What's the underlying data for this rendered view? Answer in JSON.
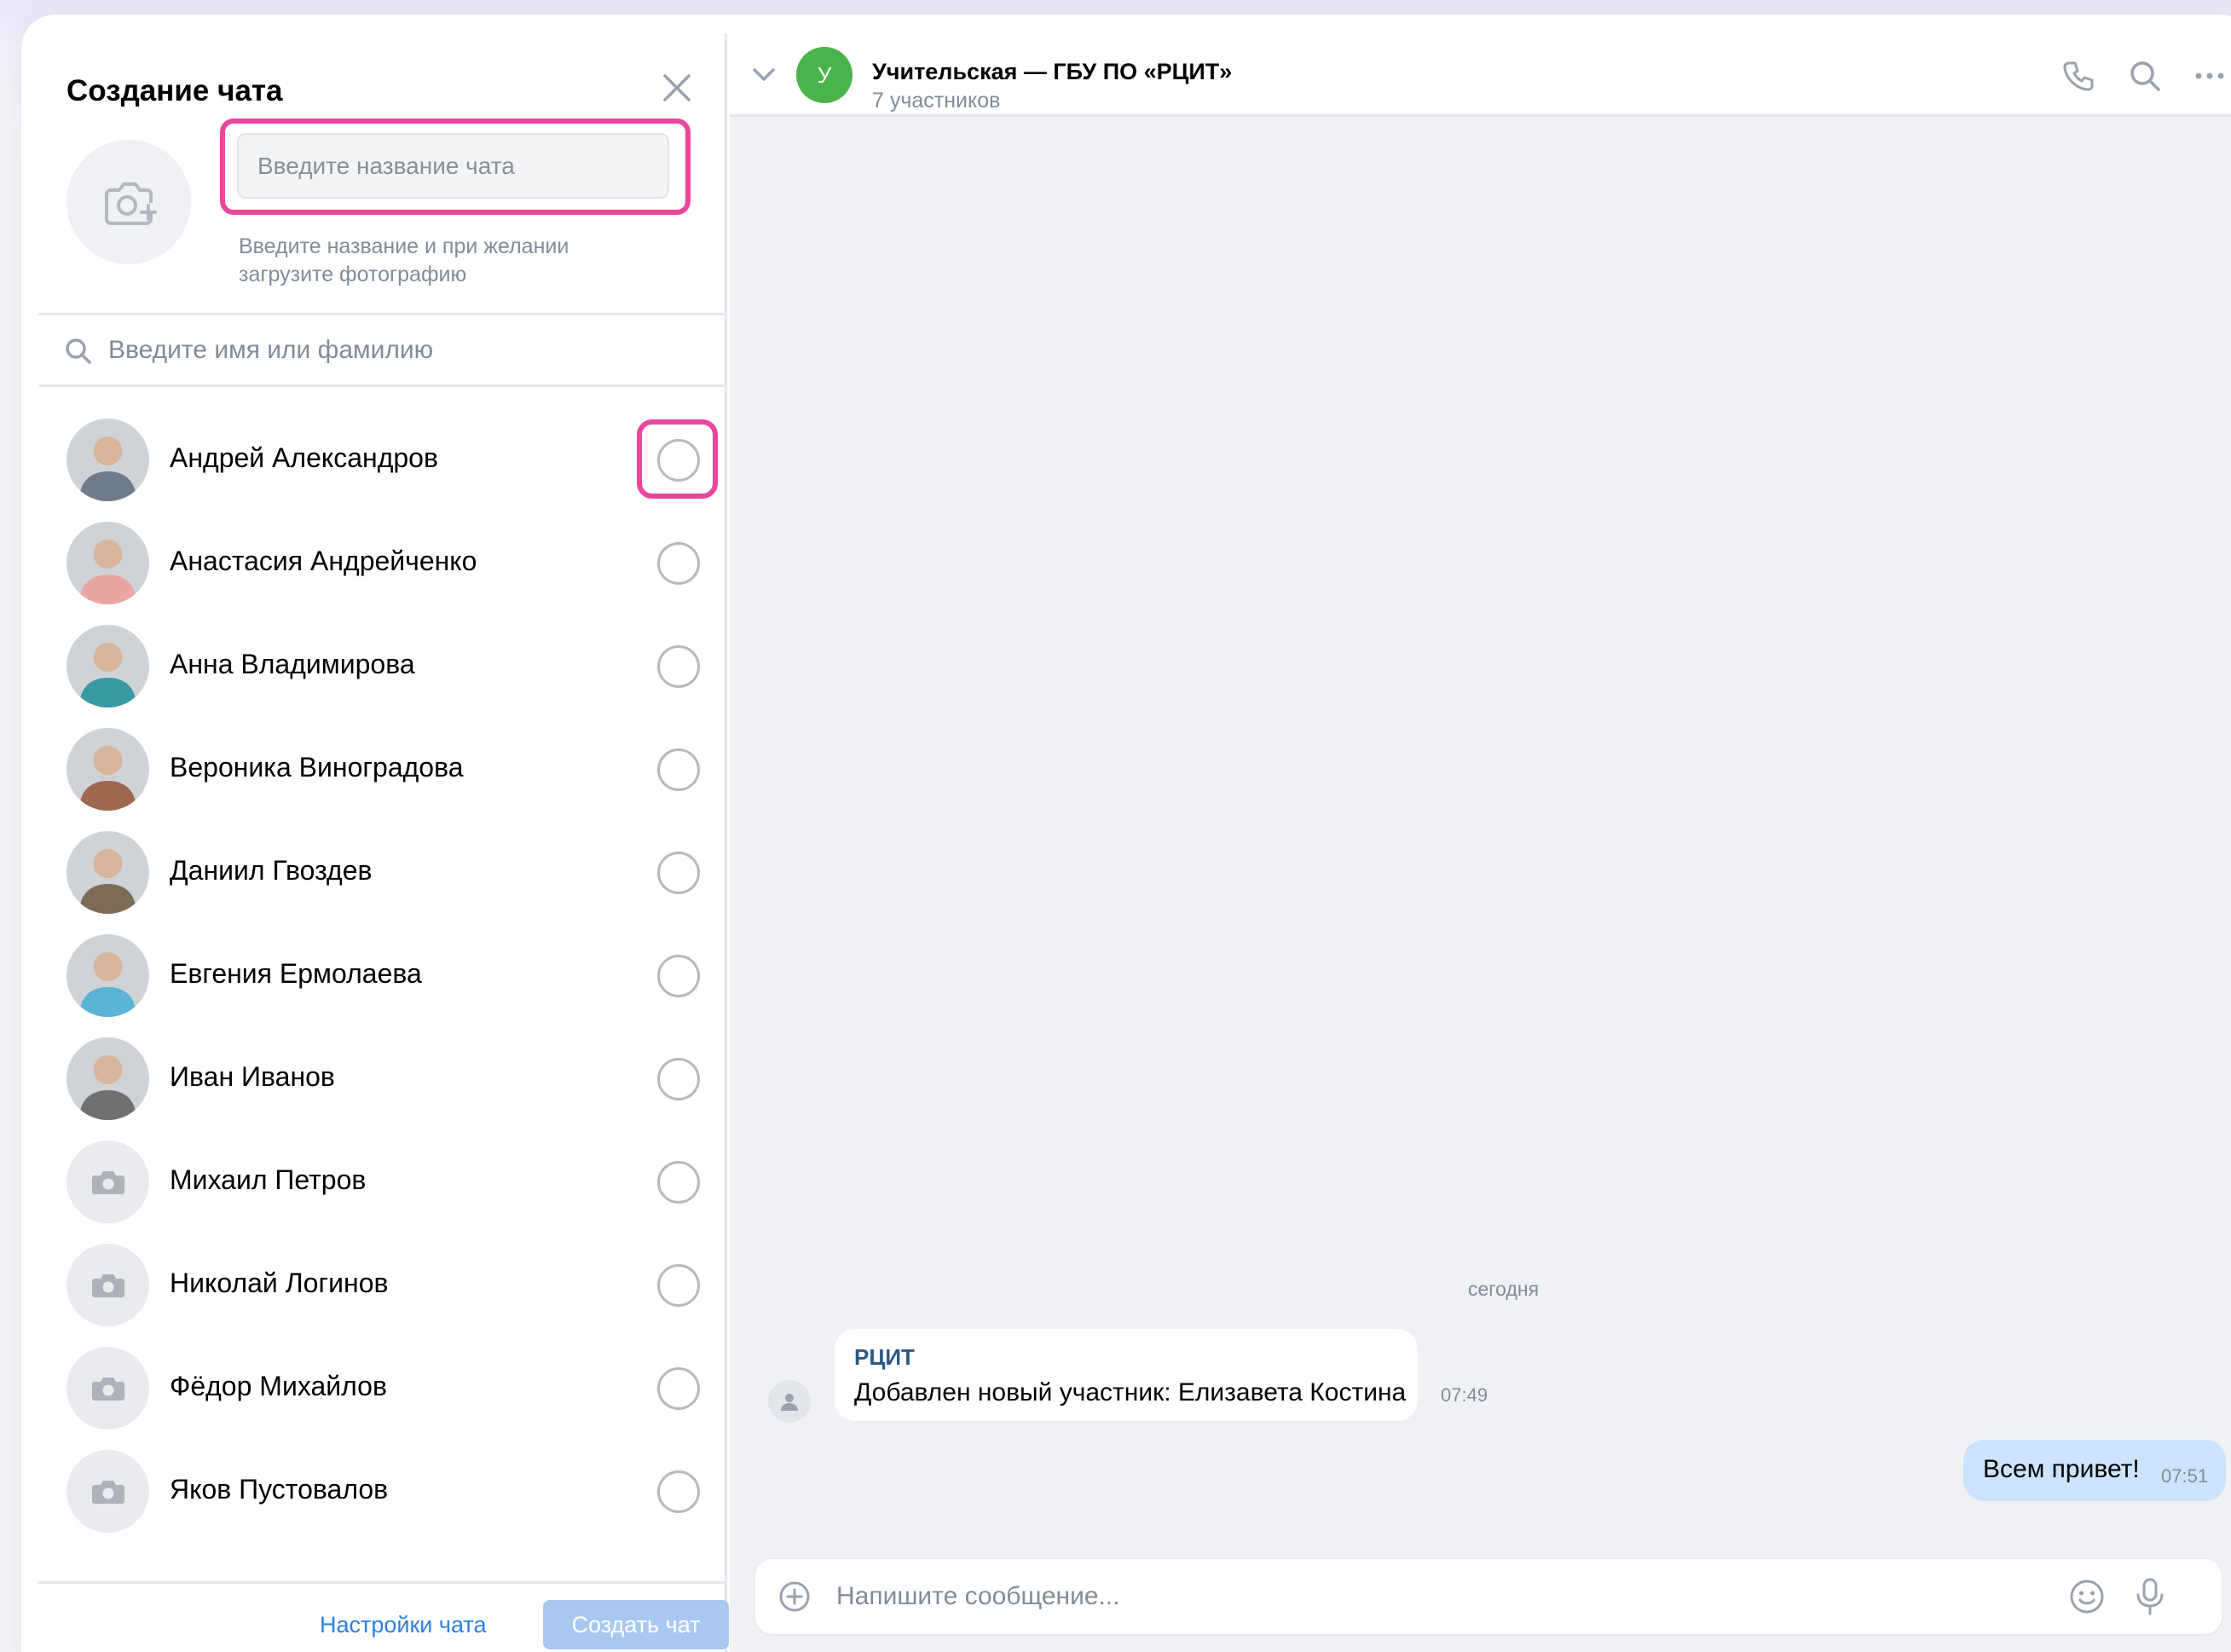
{
  "dialog": {
    "title": "Создание чата",
    "name_placeholder": "Введите название чата",
    "hint": "Введите название и при желании загрузите фотографию",
    "search_placeholder": "Введите имя или фамилию",
    "settings_label": "Настройки чата",
    "create_label": "Создать чат"
  },
  "contacts": [
    {
      "name": "Андрей Александров",
      "has_photo": true,
      "color": "#6f7b88"
    },
    {
      "name": "Анастасия Андрейченко",
      "has_photo": true,
      "color": "#e9a7a4"
    },
    {
      "name": "Анна Владимирова",
      "has_photo": true,
      "color": "#3a9aa3"
    },
    {
      "name": "Вероника Виноградова",
      "has_photo": true,
      "color": "#a0684f"
    },
    {
      "name": "Даниил Гвоздев",
      "has_photo": true,
      "color": "#7d6a57"
    },
    {
      "name": "Евгения Ермолаева",
      "has_photo": true,
      "color": "#5bb4d6"
    },
    {
      "name": "Иван Иванов",
      "has_photo": true,
      "color": "#707070"
    },
    {
      "name": "Михаил Петров",
      "has_photo": false
    },
    {
      "name": "Николай Логинов",
      "has_photo": false
    },
    {
      "name": "Фёдор Михайлов",
      "has_photo": false
    },
    {
      "name": "Яков Пустовалов",
      "has_photo": false
    }
  ],
  "chat": {
    "avatar_letter": "У",
    "title": "Учительская — ГБУ ПО «РЦИТ»",
    "subtitle": "7 участников",
    "date_separator": "сегодня",
    "messages": {
      "incoming": {
        "sender": "РЦИТ",
        "text": "Добавлен новый участник: Елизавета Костина",
        "time": "07:49"
      },
      "outgoing": {
        "text": "Всем привет!",
        "time": "07:51"
      }
    },
    "composer_placeholder": "Напишите сообщение..."
  },
  "colors": {
    "highlight": "#e8479b",
    "accent": "#2d81e0",
    "chat_avatar": "#4bb34b",
    "outgoing_bubble": "#cce4ff"
  }
}
